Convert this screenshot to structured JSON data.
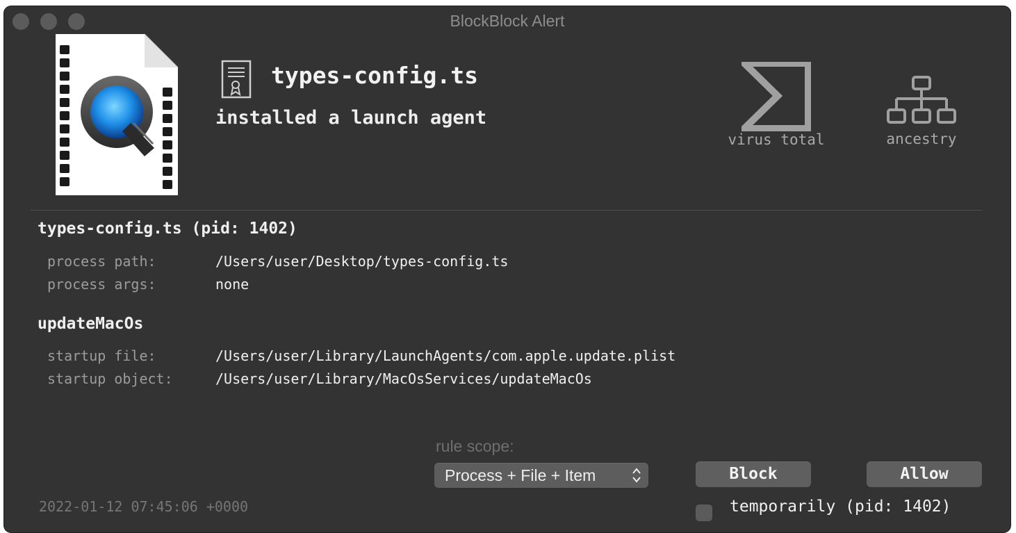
{
  "window": {
    "title": "BlockBlock Alert"
  },
  "alert": {
    "process_name": "types-config.ts",
    "action": "installed a launch agent"
  },
  "tools": {
    "virus_total_label": "virus total",
    "ancestry_label": "ancestry"
  },
  "process": {
    "heading": "types-config.ts (pid: 1402)",
    "path_label": "process path:",
    "path_value": "/Users/user/Desktop/types-config.ts",
    "args_label": "process args:",
    "args_value": "none"
  },
  "item": {
    "heading": "updateMacOs",
    "startup_file_label": "startup file:",
    "startup_file_value": "/Users/user/Library/LaunchAgents/com.apple.update.plist",
    "startup_object_label": "startup object:",
    "startup_object_value": "/Users/user/Library/MacOsServices/updateMacOs"
  },
  "footer": {
    "rule_scope_label": "rule scope:",
    "rule_scope_selected": "Process + File + Item",
    "block_label": "Block",
    "allow_label": "Allow",
    "temporarily_label": "temporarily (pid: 1402)",
    "temporarily_checked": false,
    "timestamp": "2022-01-12 07:45:06 +0000"
  },
  "icons": {
    "app": "quicktime-file-icon",
    "signature": "certificate-icon",
    "virus_total": "sigma-icon",
    "ancestry": "hierarchy-icon",
    "scope_chevron": "up-down-chevron-icon"
  },
  "colors": {
    "window_bg": "#333333",
    "button_bg": "#5f5f5f",
    "text_primary": "#f0f0f0",
    "text_muted": "#9c9c9c"
  }
}
